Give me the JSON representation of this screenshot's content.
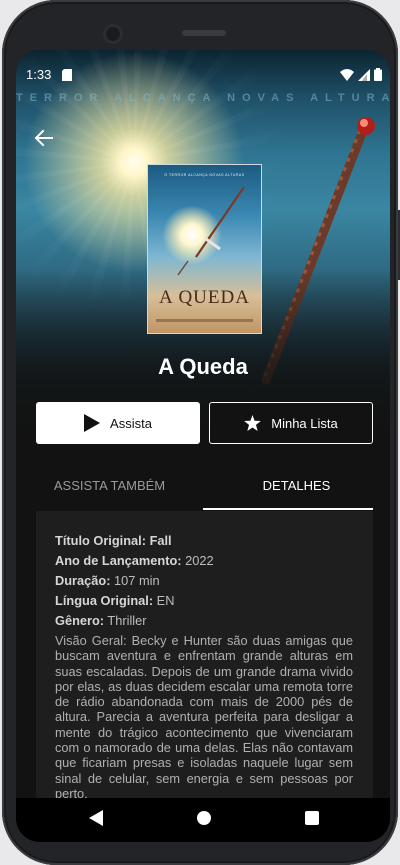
{
  "status_bar": {
    "time": "1:33",
    "icons": [
      "sim-card-icon",
      "wifi-icon",
      "signal-icon",
      "battery-icon"
    ]
  },
  "header": {
    "back_icon": "arrow-left-icon",
    "tagline": "TERROR ALCANÇA NOVAS ALTURAS"
  },
  "poster": {
    "tagline": "O TERROR ALCANÇA NOVAS ALTURAS",
    "title": "A QUEDA"
  },
  "movie": {
    "title": "A Queda"
  },
  "actions": {
    "watch_label": "Assista",
    "watch_icon": "play-icon",
    "list_label": "Minha Lista",
    "list_icon": "star-icon"
  },
  "tabs": [
    {
      "label": "ASSISTA TAMBÉM",
      "active": false
    },
    {
      "label": "DETALHES",
      "active": true
    }
  ],
  "details": {
    "original_title_label": "Título Original:",
    "original_title_value": "Fall",
    "release_year_label": "Ano de Lançamento:",
    "release_year_value": "2022",
    "duration_label": "Duração:",
    "duration_value": "107 min",
    "language_label": "Língua Original:",
    "language_value": "EN",
    "genre_label": "Gênero:",
    "genre_value": "Thriller",
    "overview_label": "Visão Geral:",
    "overview_value": "Becky e Hunter são duas amigas que buscam aventura e enfrentam grande alturas em suas escaladas. Depois de um grande drama vivido por elas, as duas decidem escalar uma remota torre de rádio abandonada com mais de 2000 pés de altura. Parecia a aventura perfeita para desligar a mente do trágico acontecimento que vivenciaram com o namorado de uma delas. Elas não contavam que ficariam presas e isoladas naquele lugar sem sinal de celular, sem energia e sem pessoas por perto."
  },
  "colors": {
    "background": "#121212",
    "panel": "#1e1e1e",
    "primary_button": "#ffffff",
    "tab_active": "#ffffff",
    "tab_inactive": "#9a9a9a"
  },
  "nav_bar": {
    "icons": [
      "back-triangle-icon",
      "home-circle-icon",
      "recents-square-icon"
    ]
  }
}
